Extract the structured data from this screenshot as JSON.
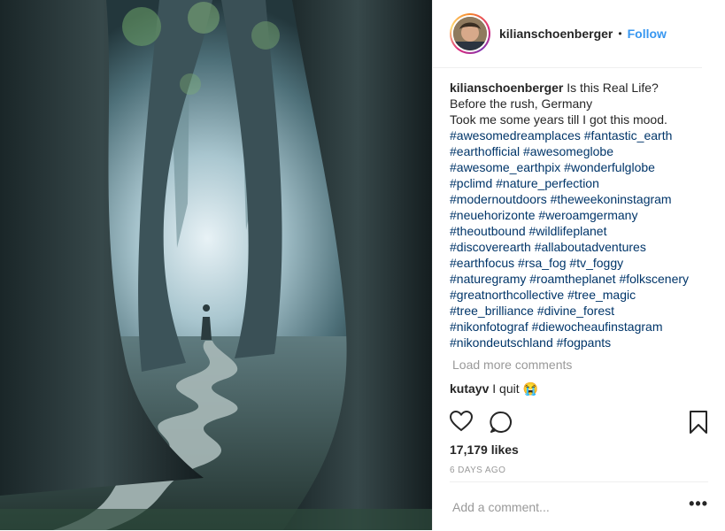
{
  "post": {
    "username": "kilianschoenberger",
    "follow_label": "Follow",
    "header_dot": "•",
    "caption_lines": [
      "Is this Real Life?",
      "Before the rush, Germany",
      "Took me some years till I got this mood."
    ],
    "hashtags": [
      "#awesomedreamplaces #fantastic_earth",
      "#earthofficial #awesomeglobe",
      "#awesome_earthpix #wonderfulglobe",
      "#pclimd #nature_perfection",
      "#modernoutdoors #theweekoninstagram",
      "#neuehorizonte #weroamgermany",
      "#theoutbound #wildlifeplanet",
      "#discoverearth #allaboutadventures",
      "#earthfocus #rsa_fog #tv_foggy",
      "#naturegramy #roamtheplanet #folkscenery",
      "#greatnorthcollective #tree_magic",
      "#tree_brilliance #divine_forest",
      "#nikonfotograf #diewocheaufinstagram",
      "#nikondeutschland #fogpants"
    ],
    "load_more": "Load more comments",
    "comment": {
      "username": "kutayv",
      "text": "I quit 😭"
    },
    "likes": "17,179 likes",
    "time": "6 DAYS AGO",
    "add_comment_placeholder": "Add a comment...",
    "more_label": "•••",
    "icons": [
      "heart-icon",
      "comment-icon",
      "bookmark-icon",
      "more-options-icon"
    ]
  }
}
